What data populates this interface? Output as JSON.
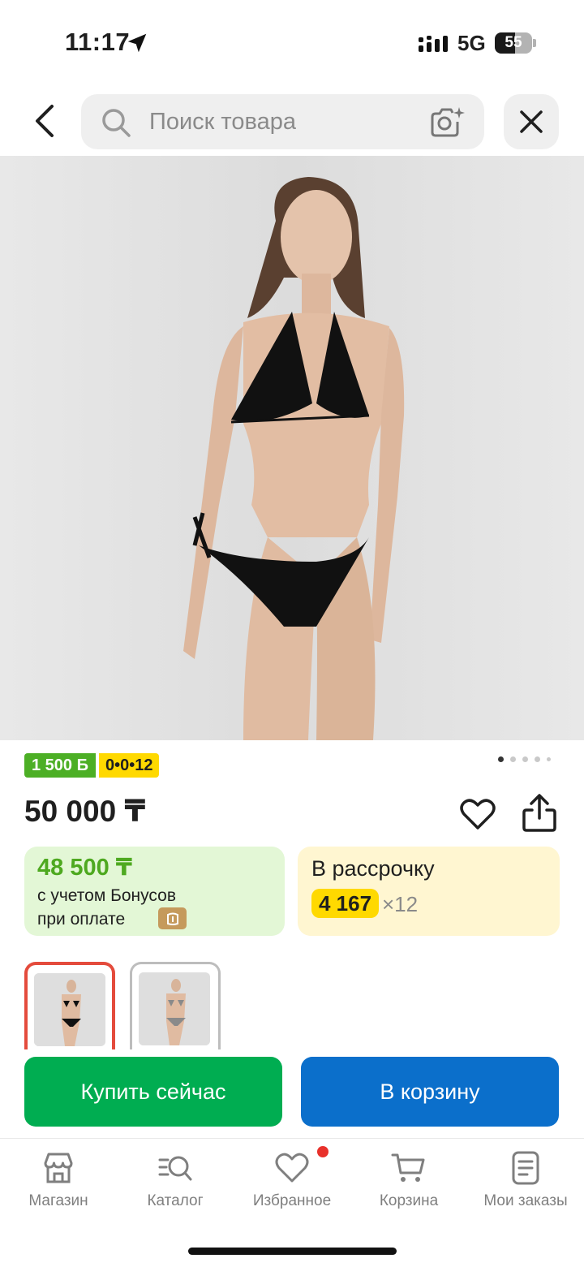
{
  "status_bar": {
    "time": "11:17",
    "network": "5G",
    "battery": "55",
    "battery_level": 0.55
  },
  "header": {
    "back_icon": "chevron-left-icon",
    "search_placeholder": "Поиск товара",
    "search_icon": "search-icon",
    "camera_icon": "camera-sparkle-icon",
    "close_icon": "close-icon"
  },
  "product": {
    "image_icon": "product-photo",
    "gallery_pages": 5,
    "gallery_active_page": 1,
    "badges": {
      "bonus": "1 500 Б",
      "installment": "0•0•12"
    },
    "price": "50 000 ₸",
    "favorite_icon": "heart-icon",
    "share_icon": "share-icon",
    "bonus_card": {
      "amount": "48 500 ₸",
      "line1": "с учетом Бонусов",
      "line2": "при оплате",
      "pay_icon": "wallet-icon"
    },
    "installment_card": {
      "title": "В рассрочку",
      "monthly": "4 167",
      "months": "×12"
    },
    "thumbnails": [
      {
        "name": "black-bikini",
        "selected": true
      },
      {
        "name": "grey-bikini",
        "selected": false
      }
    ]
  },
  "actions": {
    "buy_now": "Купить сейчас",
    "add_to_cart": "В корзину"
  },
  "bottom_nav": {
    "items": [
      {
        "label": "Магазин",
        "icon": "store-icon"
      },
      {
        "label": "Каталог",
        "icon": "catalog-search-icon"
      },
      {
        "label": "Избранное",
        "icon": "heart-icon",
        "has_notification": true
      },
      {
        "label": "Корзина",
        "icon": "cart-icon"
      },
      {
        "label": "Мои заказы",
        "icon": "orders-icon"
      }
    ]
  },
  "colors": {
    "buy_button": "#00ad51",
    "cart_button": "#0b6fcb",
    "bonus_green": "#4ea920",
    "installment_yellow": "#ffd900",
    "notification_red": "#e8312b"
  }
}
